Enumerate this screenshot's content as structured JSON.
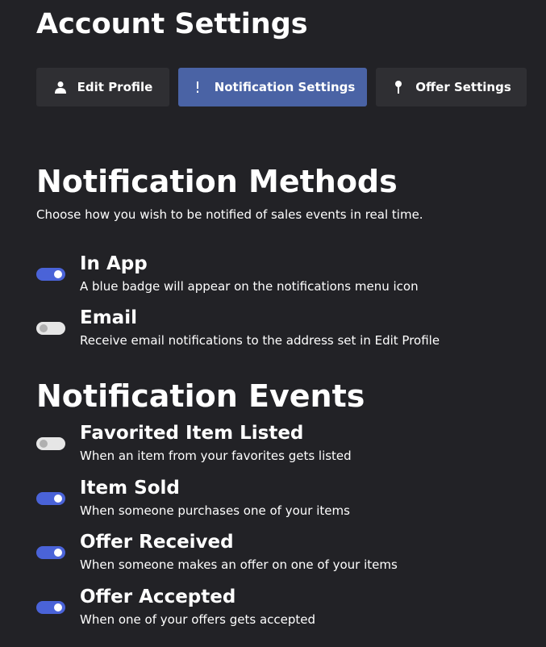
{
  "page": {
    "title": "Account Settings"
  },
  "tabs": [
    {
      "label": "Edit Profile",
      "icon": "user-icon",
      "active": false
    },
    {
      "label": "Notification Settings",
      "icon": "exclamation-icon",
      "active": true
    },
    {
      "label": "Offer Settings",
      "icon": "pin-icon",
      "active": false
    }
  ],
  "methods": {
    "title": "Notification Methods",
    "description": "Choose how you wish to be notified of sales events in real time.",
    "items": [
      {
        "label": "In App",
        "description": "A blue badge will appear on the notifications menu icon",
        "enabled": true
      },
      {
        "label": "Email",
        "description": "Receive email notifications to the address set in Edit Profile",
        "enabled": false
      }
    ]
  },
  "events": {
    "title": "Notification Events",
    "items": [
      {
        "label": "Favorited Item Listed",
        "description": "When an item from your favorites gets listed",
        "enabled": false
      },
      {
        "label": "Item Sold",
        "description": "When someone purchases one of your items",
        "enabled": true
      },
      {
        "label": "Offer Received",
        "description": "When someone makes an offer on one of your items",
        "enabled": true
      },
      {
        "label": "Offer Accepted",
        "description": "When one of your offers gets accepted",
        "enabled": true
      }
    ]
  },
  "colors": {
    "background": "#222226",
    "tab_background": "#2f2f33",
    "tab_active": "#4a63a5",
    "toggle_on": "#4a63d8",
    "toggle_off": "#e6e6e6"
  }
}
